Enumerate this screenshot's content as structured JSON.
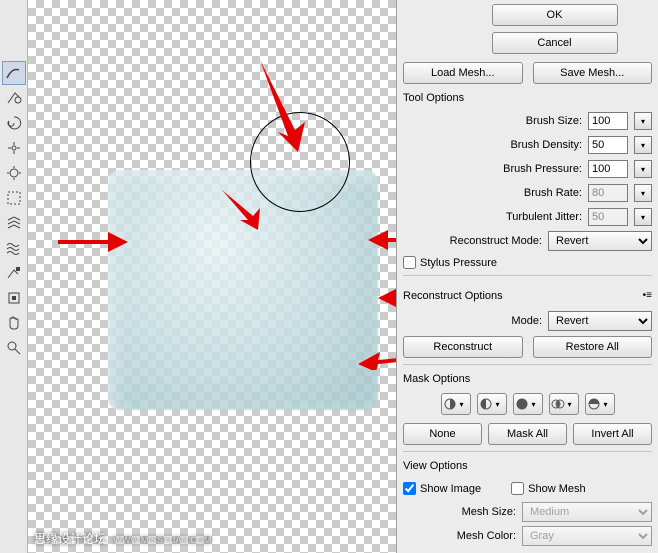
{
  "buttons": {
    "ok": "OK",
    "cancel": "Cancel",
    "loadMesh": "Load Mesh...",
    "saveMesh": "Save Mesh...",
    "reconstruct": "Reconstruct",
    "restoreAll": "Restore All",
    "none": "None",
    "maskAll": "Mask All",
    "invertAll": "Invert All"
  },
  "sections": {
    "toolOptions": "Tool Options",
    "reconstructOptions": "Reconstruct Options",
    "maskOptions": "Mask Options",
    "viewOptions": "View Options"
  },
  "fields": {
    "brushSize": {
      "label": "Brush Size:",
      "value": "100"
    },
    "brushDensity": {
      "label": "Brush Density:",
      "value": "50"
    },
    "brushPressure": {
      "label": "Brush Pressure:",
      "value": "100"
    },
    "brushRate": {
      "label": "Brush Rate:",
      "value": "80"
    },
    "turbulentJitter": {
      "label": "Turbulent Jitter:",
      "value": "50"
    },
    "reconstructMode": {
      "label": "Reconstruct Mode:",
      "value": "Revert"
    },
    "stylusPressure": "Stylus Pressure",
    "mode": {
      "label": "Mode:",
      "value": "Revert"
    },
    "showImage": "Show Image",
    "showMesh": "Show Mesh",
    "meshSize": {
      "label": "Mesh Size:",
      "value": "Medium"
    },
    "meshColor": {
      "label": "Mesh Color:",
      "value": "Gray"
    }
  },
  "watermark": {
    "main": "思缘设计论坛",
    "sub": "WWW.MISSYUAN.COM"
  }
}
